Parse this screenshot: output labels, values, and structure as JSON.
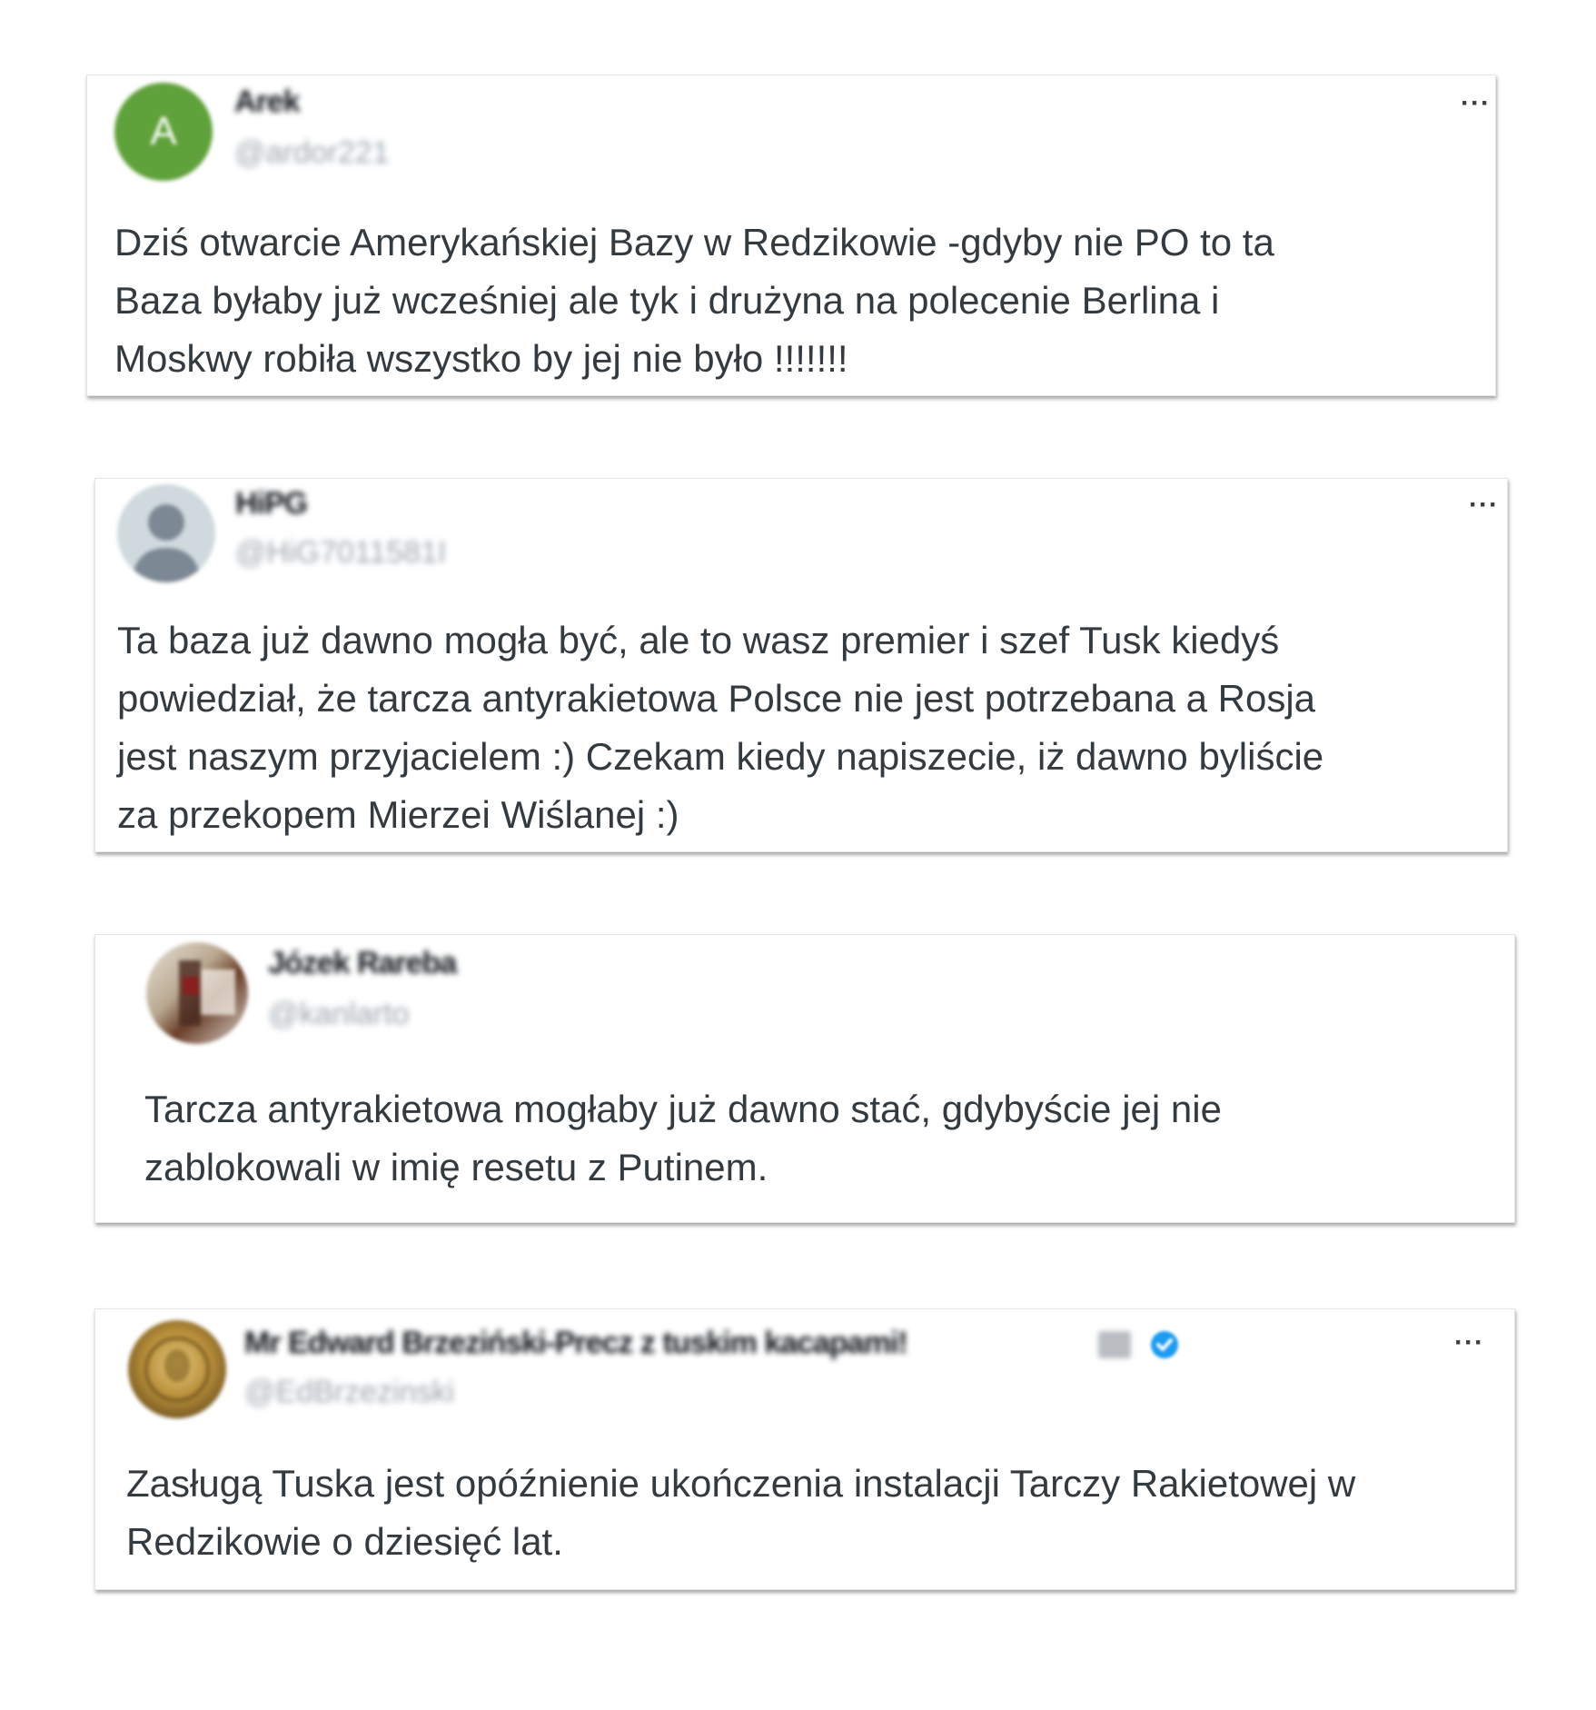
{
  "tweets": [
    {
      "avatar_letter": "A",
      "avatar_color": "#5fa13a",
      "name": "Arek",
      "handle": "@ardor221",
      "more": "···",
      "lines": [
        "Dziś otwarcie Amerykańskiej Bazy w Redzikowie -gdyby nie PO to ta",
        "Baza byłaby już wcześniej ale tyk i drużyna na polecenie Berlina i",
        "Moskwy robiła wszystko by jej nie było !!!!!!!"
      ]
    },
    {
      "avatar_color": "#cfd9de",
      "name": "HiPG",
      "handle": "@HiG7011581I",
      "more": "···",
      "lines": [
        "Ta baza już dawno mogła być, ale to wasz premier i szef Tusk kiedyś",
        "powiedział, że tarcza antyrakietowa Polsce nie jest potrzebana a Rosja",
        "jest naszym przyjacielem :) Czekam kiedy napiszecie, iż dawno byliście",
        "za przekopem Mierzei Wiślanej :)"
      ]
    },
    {
      "name": "Józek Rareba",
      "handle": "@kanlarto",
      "lines": [
        "Tarcza antyrakietowa mogłaby już dawno stać, gdybyście jej nie",
        "zablokowali w imię resetu z Putinem."
      ]
    },
    {
      "name": "Mr Edward Brzeziński-Precz z tuskim kacapami!",
      "handle": "@EdBrzezinski",
      "more": "···",
      "verified_color": "#1d9bf0",
      "lines": [
        "Zasługą Tuska jest opóźnienie ukończenia instalacji Tarczy Rakietowej w",
        "Redzikowie o dziesięć lat."
      ]
    }
  ]
}
